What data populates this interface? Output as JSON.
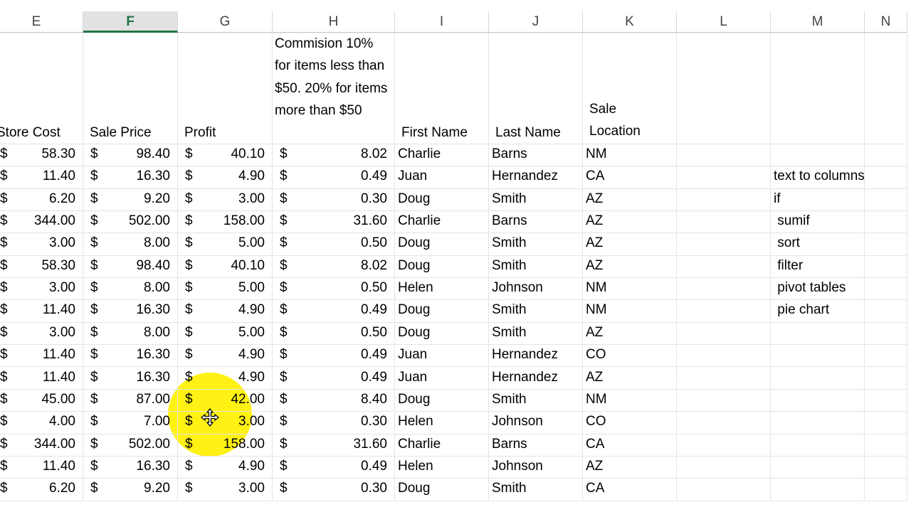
{
  "columns": [
    {
      "letter": "E",
      "width": 131
    },
    {
      "letter": "F",
      "width": 133,
      "selected": true
    },
    {
      "letter": "G",
      "width": 133
    },
    {
      "letter": "H",
      "width": 172
    },
    {
      "letter": "I",
      "width": 132
    },
    {
      "letter": "J",
      "width": 132
    },
    {
      "letter": "K",
      "width": 132
    },
    {
      "letter": "L",
      "width": 132
    },
    {
      "letter": "M",
      "width": 132
    },
    {
      "letter": "N",
      "width": 60
    }
  ],
  "headers": {
    "store_cost": "Store Cost",
    "sale_price": "Sale Price",
    "profit": "Profit",
    "commission": "Commision 10% for items less than $50. 20% for items more than $50",
    "first_name": "First Name",
    "last_name": "Last Name",
    "location_line1": "Sale",
    "location_line2": "Location"
  },
  "currency_symbol": "$",
  "rows": [
    {
      "store_cost": "58.30",
      "sale_price": "98.40",
      "profit": "40.10",
      "commission": "8.02",
      "first": "Charlie",
      "last": "Barns",
      "location": "NM",
      "note": ""
    },
    {
      "store_cost": "11.40",
      "sale_price": "16.30",
      "profit": "4.90",
      "commission": "0.49",
      "first": "Juan",
      "last": "Hernandez",
      "location": "CA",
      "note": "text to columns"
    },
    {
      "store_cost": "6.20",
      "sale_price": "9.20",
      "profit": "3.00",
      "commission": "0.30",
      "first": "Doug",
      "last": "Smith",
      "location": "AZ",
      "note": "if"
    },
    {
      "store_cost": "344.00",
      "sale_price": "502.00",
      "profit": "158.00",
      "commission": "31.60",
      "first": "Charlie",
      "last": "Barns",
      "location": "AZ",
      "note": " sumif"
    },
    {
      "store_cost": "3.00",
      "sale_price": "8.00",
      "profit": "5.00",
      "commission": "0.50",
      "first": "Doug",
      "last": "Smith",
      "location": "AZ",
      "note": " sort"
    },
    {
      "store_cost": "58.30",
      "sale_price": "98.40",
      "profit": "40.10",
      "commission": "8.02",
      "first": "Doug",
      "last": "Smith",
      "location": "AZ",
      "note": " filter"
    },
    {
      "store_cost": "3.00",
      "sale_price": "8.00",
      "profit": "5.00",
      "commission": "0.50",
      "first": "Helen",
      "last": "Johnson",
      "location": "NM",
      "note": " pivot tables"
    },
    {
      "store_cost": "11.40",
      "sale_price": "16.30",
      "profit": "4.90",
      "commission": "0.49",
      "first": "Doug",
      "last": "Smith",
      "location": "NM",
      "note": " pie chart"
    },
    {
      "store_cost": "3.00",
      "sale_price": "8.00",
      "profit": "5.00",
      "commission": "0.50",
      "first": "Doug",
      "last": "Smith",
      "location": "AZ",
      "note": ""
    },
    {
      "store_cost": "11.40",
      "sale_price": "16.30",
      "profit": "4.90",
      "commission": "0.49",
      "first": "Juan",
      "last": "Hernandez",
      "location": "CO",
      "note": ""
    },
    {
      "store_cost": "11.40",
      "sale_price": "16.30",
      "profit": "4.90",
      "commission": "0.49",
      "first": "Juan",
      "last": "Hernandez",
      "location": "AZ",
      "note": ""
    },
    {
      "store_cost": "45.00",
      "sale_price": "87.00",
      "profit": "42.00",
      "commission": "8.40",
      "first": "Doug",
      "last": "Smith",
      "location": "NM",
      "note": ""
    },
    {
      "store_cost": "4.00",
      "sale_price": "7.00",
      "profit": "3.00",
      "commission": "0.30",
      "first": "Helen",
      "last": "Johnson",
      "location": "CO",
      "note": ""
    },
    {
      "store_cost": "344.00",
      "sale_price": "502.00",
      "profit": "158.00",
      "commission": "31.60",
      "first": "Charlie",
      "last": "Barns",
      "location": "CA",
      "note": ""
    },
    {
      "store_cost": "11.40",
      "sale_price": "16.30",
      "profit": "4.90",
      "commission": "0.49",
      "first": "Helen",
      "last": "Johnson",
      "location": "AZ",
      "note": ""
    },
    {
      "store_cost": "6.20",
      "sale_price": "9.20",
      "profit": "3.00",
      "commission": "0.30",
      "first": "Doug",
      "last": "Smith",
      "location": "CA",
      "note": ""
    }
  ]
}
